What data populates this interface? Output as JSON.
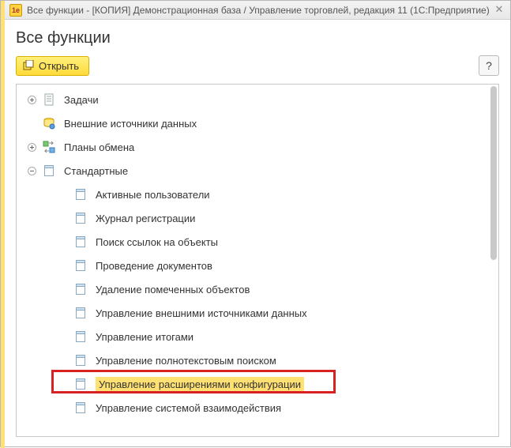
{
  "titlebar": {
    "text": "Все функции - [КОПИЯ] Демонстрационная база / Управление торговлей, редакция 11  (1С:Предприятие)",
    "app_icon_label": "1e"
  },
  "page_title": "Все функции",
  "toolbar": {
    "open_label": "Открыть",
    "help_label": "?"
  },
  "tree": {
    "items": [
      {
        "depth": 0,
        "expander": "plus",
        "icon": "doc",
        "label": "Задачи"
      },
      {
        "depth": 0,
        "expander": "none",
        "icon": "extsource",
        "label": "Внешние источники данных"
      },
      {
        "depth": 0,
        "expander": "plus",
        "icon": "exchange",
        "label": "Планы обмена"
      },
      {
        "depth": 0,
        "expander": "minus",
        "icon": "leaf",
        "label": "Стандартные"
      },
      {
        "depth": 1,
        "expander": "none",
        "icon": "leaf",
        "label": "Активные пользователи"
      },
      {
        "depth": 1,
        "expander": "none",
        "icon": "leaf",
        "label": "Журнал регистрации"
      },
      {
        "depth": 1,
        "expander": "none",
        "icon": "leaf",
        "label": "Поиск ссылок на объекты"
      },
      {
        "depth": 1,
        "expander": "none",
        "icon": "leaf",
        "label": "Проведение документов"
      },
      {
        "depth": 1,
        "expander": "none",
        "icon": "leaf",
        "label": "Удаление помеченных объектов"
      },
      {
        "depth": 1,
        "expander": "none",
        "icon": "leaf",
        "label": "Управление внешними источниками данных"
      },
      {
        "depth": 1,
        "expander": "none",
        "icon": "leaf",
        "label": "Управление итогами"
      },
      {
        "depth": 1,
        "expander": "none",
        "icon": "leaf",
        "label": "Управление полнотекстовым поиском"
      },
      {
        "depth": 1,
        "expander": "none",
        "icon": "leaf",
        "label": "Управление расширениями конфигурации",
        "highlight": true
      },
      {
        "depth": 1,
        "expander": "none",
        "icon": "leaf",
        "label": "Управление системой взаимодействия"
      }
    ]
  }
}
